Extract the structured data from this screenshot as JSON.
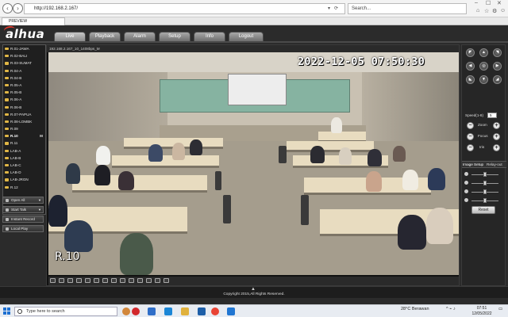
{
  "browser": {
    "url": "http://192.168.2.167/",
    "search_placeholder": "Search...",
    "tab_title": "PREVIEW"
  },
  "app": {
    "logo": "alhua",
    "menu": [
      "Live",
      "Playback",
      "Alarm",
      "Setup",
      "Info",
      "Logout"
    ],
    "active_tab": "Live"
  },
  "channels": [
    "R.01-JAWA",
    "R.02-BALI",
    "R.03-SUMAT",
    "R.04-A",
    "R.04-B",
    "R.05-A",
    "R.05-B",
    "R.06-A",
    "R.06-B",
    "R.07-PAPUA",
    "R.08-LOMBK",
    "R.09",
    "R.10",
    "R.11",
    "LAB-A",
    "LAB-B",
    "LAB-C",
    "LAB-D",
    "LAB-JRGN",
    "R.12"
  ],
  "selected_channel": "R.10",
  "selected_channel_flag": "M",
  "side_buttons": [
    "Open All",
    "Start Talk",
    "Instant Record",
    "Local Play"
  ],
  "video": {
    "title": "192.168.2.167_10_1408bps_M",
    "osd_time": "2022-12-05 07:50:30",
    "osd_name": "R.10"
  },
  "ptz": {
    "speed_label": "Speed(1-8)",
    "speed_value": "5",
    "zoom_label": "Zoom",
    "focus_label": "Focus",
    "iris_label": "Iris"
  },
  "image_setup": {
    "tab1": "Image Setup",
    "tab2": "Relay-out",
    "reset_label": "Reset",
    "levels": [
      0.5,
      0.5,
      0.5,
      0.5
    ]
  },
  "footer": {
    "copyright": "Copyright 2015,All Rights Reserved."
  },
  "taskbar": {
    "search_placeholder": "Type here to search",
    "weather": "28°C Berawan",
    "time": "07:51",
    "date": "12/05/2022"
  }
}
